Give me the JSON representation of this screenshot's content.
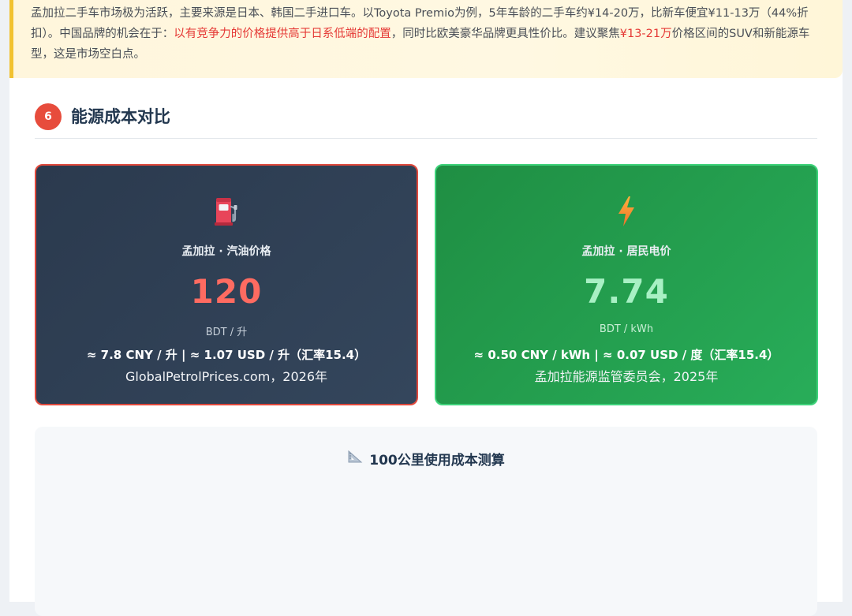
{
  "callout": {
    "line1": "孟加拉二手车市场极为活跃，主要来源是日本、韩国二手进口车。以Toyota Premio为例，5年车龄的二手车约¥14-20万，比新车便宜¥11-13万（44%折",
    "line2_pre": "扣）。中国品牌的机会在于：",
    "line2_highlight": "以有竞争力的价格提供高于日系低端的配置",
    "line2_mid": "，同时比欧美豪华品牌更具性价比。建议聚焦",
    "line2_highlight2": "¥13-21万",
    "line2_post": "价格区间的SUV和新能源车",
    "line3": "型，这是市场空白点。",
    "colors": {
      "highlight": "#e53935",
      "border": "#f2c230"
    }
  },
  "section": {
    "number": "6",
    "title": "能源成本对比"
  },
  "cards": {
    "fuel": {
      "icon": "fuel-pump-icon",
      "label": "孟加拉 · 汽油价格",
      "value": "120",
      "unit": "BDT / 升",
      "conversion": "≈ 7.8 CNY / 升 | ≈ 1.07 USD / 升（汇率15.4）",
      "source": "GlobalPetrolPrices.com，2026年",
      "color": "#ff6b61"
    },
    "electricity": {
      "icon": "lightning-bolt-icon",
      "label": "孟加拉 · 居民电价",
      "value": "7.74",
      "unit": "BDT / kWh",
      "conversion": "≈ 0.50 CNY / kWh | ≈ 0.07 USD / 度（汇率15.4）",
      "source": "孟加拉能源监管委员会，2025年",
      "color": "#a8f0c4"
    }
  },
  "calc": {
    "icon": "triangle-ruler-icon",
    "title": "100公里使用成本测算"
  }
}
